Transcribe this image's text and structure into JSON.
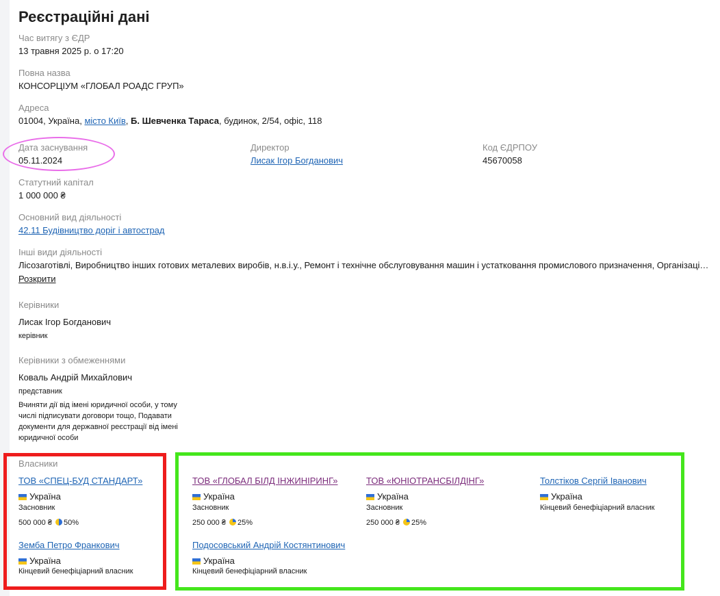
{
  "title": "Реєстраційні дані",
  "extract_time": {
    "label": "Час витягу з ЄДР",
    "value": "13 травня 2025 р. о 17:20"
  },
  "full_name": {
    "label": "Повна назва",
    "value": "КОНСОРЦІУМ «ГЛОБАЛ РОАДС ГРУП»"
  },
  "address": {
    "label": "Адреса",
    "prefix": "01004, Україна,",
    "city": "місто Київ",
    "street": "Б. Шевченка Тараса",
    "suffix": ", будинок, 2/54, офіс, 118"
  },
  "founding_date": {
    "label": "Дата заснування",
    "value": "05.11.2024"
  },
  "director": {
    "label": "Директор",
    "value": "Лисак Ігор Богданович"
  },
  "edrpou": {
    "label": "Код ЄДРПОУ",
    "value": "45670058"
  },
  "capital": {
    "label": "Статутний капітал",
    "value": "1 000 000 ₴"
  },
  "main_activity": {
    "label": "Основний вид діяльності",
    "value": "42.11 Будівництво доріг і автострад"
  },
  "other_activities": {
    "label": "Інші види діяльності",
    "value": "Лісозаготівлі, Виробництво інших готових металевих виробів, н.в.і.у., Ремонт і технічне обслуговування машин і устатковання промислового призначення, Організація будівництва будівель",
    "expand": "Розкрити"
  },
  "managers": {
    "label": "Керівники",
    "items": [
      {
        "name": "Лисак Ігор Богданович",
        "role": "керівник"
      }
    ]
  },
  "restricted_managers": {
    "label": "Керівники з обмеженнями",
    "items": [
      {
        "name": "Коваль Андрій Михайлович",
        "role": "представник",
        "note": "Вчиняти дії від імені юридичної особи, у тому числі підписувати договори тощо, Подавати документи для державної реєстрації від імені юридичної особи"
      }
    ]
  },
  "owners": {
    "label": "Власники",
    "items": [
      {
        "name": "ТОВ «СПЕЦ-БУД СТАНДАРТ»",
        "country": "Україна",
        "role": "Засновник",
        "amount": "500 000 ₴",
        "share": "50%"
      },
      {
        "name": "ТОВ «ГЛОБАЛ БІЛД ІНЖИНІРИНГ»",
        "country": "Україна",
        "role": "Засновник",
        "amount": "250 000 ₴",
        "share": "25%"
      },
      {
        "name": "ТОВ «ЮНІОТРАНСБІЛДІНГ»",
        "country": "Україна",
        "role": "Засновник",
        "amount": "250 000 ₴",
        "share": "25%"
      },
      {
        "name": "Толстіков Сергій Іванович",
        "country": "Україна",
        "role": "Кінцевий бенефіціарний власник"
      },
      {
        "name": "Земба Петро Франкович",
        "country": "Україна",
        "role": "Кінцевий бенефіціарний власник"
      },
      {
        "name": "Подосовський Андрій Костянтинович",
        "country": "Україна",
        "role": "Кінцевий бенефіціарний власник"
      }
    ]
  },
  "colors": {
    "link": "#1e64b4",
    "visited_link": "#7a2a7a",
    "annotation_pink": "#e96de9",
    "annotation_red": "#ee1c1c",
    "annotation_green": "#44e61c"
  }
}
